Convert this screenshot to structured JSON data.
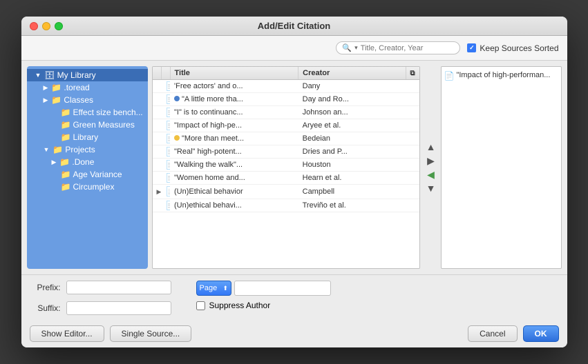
{
  "window": {
    "title": "Add/Edit Citation"
  },
  "toolbar": {
    "search_placeholder": "Title, Creator, Year",
    "keep_sorted_label": "Keep Sources Sorted"
  },
  "sidebar": {
    "items": [
      {
        "id": "my-library",
        "label": "My Library",
        "level": 0,
        "type": "library",
        "expanded": true,
        "selected": true
      },
      {
        "id": "toread",
        "label": ".toread",
        "level": 1,
        "type": "folder",
        "hasArrow": true
      },
      {
        "id": "classes",
        "label": "Classes",
        "level": 1,
        "type": "folder",
        "hasArrow": true
      },
      {
        "id": "effect-size",
        "label": "Effect size bench...",
        "level": 2,
        "type": "folder"
      },
      {
        "id": "green-measures",
        "label": "Green Measures",
        "level": 2,
        "type": "folder"
      },
      {
        "id": "library",
        "label": "Library",
        "level": 2,
        "type": "folder"
      },
      {
        "id": "projects",
        "label": "Projects",
        "level": 1,
        "type": "folder",
        "hasArrow": true,
        "expanded": true
      },
      {
        "id": "done",
        "label": ".Done",
        "level": 2,
        "type": "folder",
        "hasArrow": true
      },
      {
        "id": "age-variance",
        "label": "Age Variance",
        "level": 2,
        "type": "folder"
      },
      {
        "id": "circumplex",
        "label": "Circumplex",
        "level": 2,
        "type": "folder"
      }
    ]
  },
  "table": {
    "columns": [
      {
        "id": "expand",
        "label": ""
      },
      {
        "id": "icon",
        "label": ""
      },
      {
        "id": "title",
        "label": "Title"
      },
      {
        "id": "creator",
        "label": "Creator"
      },
      {
        "id": "attach",
        "label": ""
      }
    ],
    "rows": [
      {
        "expand": "",
        "dot": "",
        "title": "'Free actors' and o...",
        "creator": "Dany"
      },
      {
        "expand": "",
        "dot": "blue",
        "title": "\"A little more tha...",
        "creator": "Day and Ro..."
      },
      {
        "expand": "",
        "dot": "",
        "title": "\"I\" is to continuanc...",
        "creator": "Johnson an..."
      },
      {
        "expand": "",
        "dot": "",
        "title": "\"Impact of high-pe...",
        "creator": "Aryee et al."
      },
      {
        "expand": "",
        "dot": "yellow",
        "title": "\"More than meet...",
        "creator": "Bedeian"
      },
      {
        "expand": "",
        "dot": "",
        "title": "\"Real\" high-potent...",
        "creator": "Dries and P..."
      },
      {
        "expand": "",
        "dot": "",
        "title": "\"Walking the walk\"...",
        "creator": "Houston"
      },
      {
        "expand": "",
        "dot": "",
        "title": "\"Women home and...",
        "creator": "Hearn et al."
      },
      {
        "expand": "true",
        "dot": "red",
        "title": "(Un)Ethical behavior",
        "creator": "Campbell"
      },
      {
        "expand": "",
        "dot": "",
        "title": "(Un)ethical behavi...",
        "creator": "Treviño et al."
      }
    ]
  },
  "right_panel": {
    "items": [
      {
        "text": "\"Impact of high-performan..."
      }
    ]
  },
  "form": {
    "prefix_label": "Prefix:",
    "suffix_label": "Suffix:",
    "page_option": "Page",
    "suppress_author_label": "Suppress Author"
  },
  "buttons": {
    "show_editor": "Show Editor...",
    "single_source": "Single Source...",
    "cancel": "Cancel",
    "ok": "OK"
  }
}
